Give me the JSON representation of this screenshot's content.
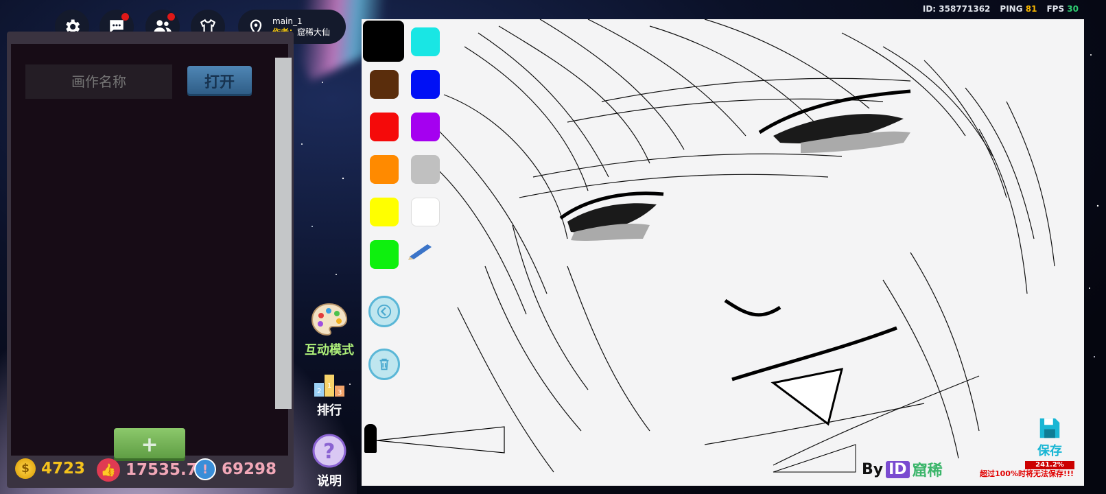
{
  "topbar": {
    "map_name": "main_1",
    "author_label": "作者：",
    "author_name": "窟稀大仙",
    "id_text": "ID: 358771362",
    "ping_label": "PING",
    "ping_value": "81",
    "fps_label": "FPS",
    "fps_value": "30",
    "buttons": [
      "gear-icon",
      "chat-icon",
      "friends-icon",
      "shirt-icon"
    ]
  },
  "panel": {
    "name_placeholder": "画作名称",
    "open_label": "打开",
    "add_label": "+"
  },
  "currencies": {
    "coins": "4723",
    "likes": "17535.7",
    "alerts": "69298"
  },
  "side_menu": {
    "interactive_label": "互动模式",
    "rank_label": "排行",
    "help_label": "说明"
  },
  "palette": {
    "colors": [
      "#000000",
      "#19e6e4",
      "#5a2d0c",
      "#0010f5",
      "#f50a0a",
      "#a500f0",
      "#ff8a00",
      "#c0c0c0",
      "#ffff00",
      "#ffffff",
      "#0ef00e"
    ]
  },
  "canvas": {
    "by_label": "By",
    "id_badge": "ID",
    "by_name": "窟稀",
    "save_label": "保存",
    "usage_percent": "241.2%",
    "warning": "超过100%时将无法保存!!!"
  },
  "colors": {
    "accent_blue": "#19b6d4",
    "warning_red": "#e00000",
    "add_green": "#6aac4c"
  }
}
